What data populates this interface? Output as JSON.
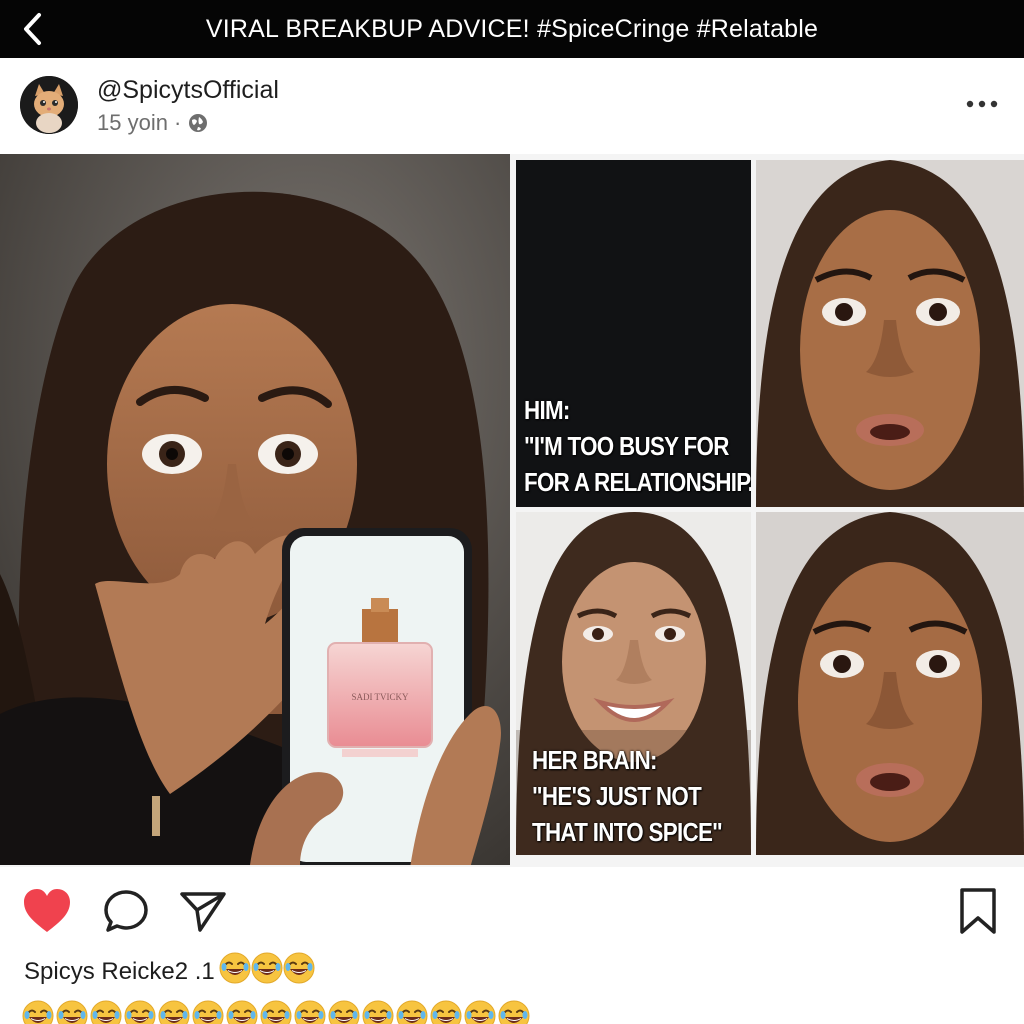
{
  "header": {
    "back_icon": "chevron-left-icon",
    "title": "VIRAL BREAKBUP ADVICE! #SpiceCringe #Relatable"
  },
  "post": {
    "username": "@SpicytsOfficial",
    "time": "15 yoin",
    "separator": "·",
    "privacy_icon": "globe-icon",
    "more_icon": "more-horizontal-icon"
  },
  "media": {
    "panel_text_top": "HIM:\n\"I'M TOO BUSY FOR\nFOR A RELATIONSHIP.\"",
    "panel_text_bottom": "HER BRAIN:\n\"HE'S JUST NOT\nTHAT INTO SPICE\"",
    "perfume_label": "SADI TVICKY"
  },
  "actions": {
    "like_icon": "heart-icon",
    "comment_icon": "comment-icon",
    "share_icon": "send-icon",
    "save_icon": "bookmark-icon",
    "like_color": "#f0424e"
  },
  "caption": {
    "text": "Spicys Reicke2 .1",
    "emoji_icon": "laughing-emoji-icon"
  },
  "colors": {
    "topbar": "#050505",
    "meme_panel": "#111214",
    "like": "#f0424e"
  }
}
